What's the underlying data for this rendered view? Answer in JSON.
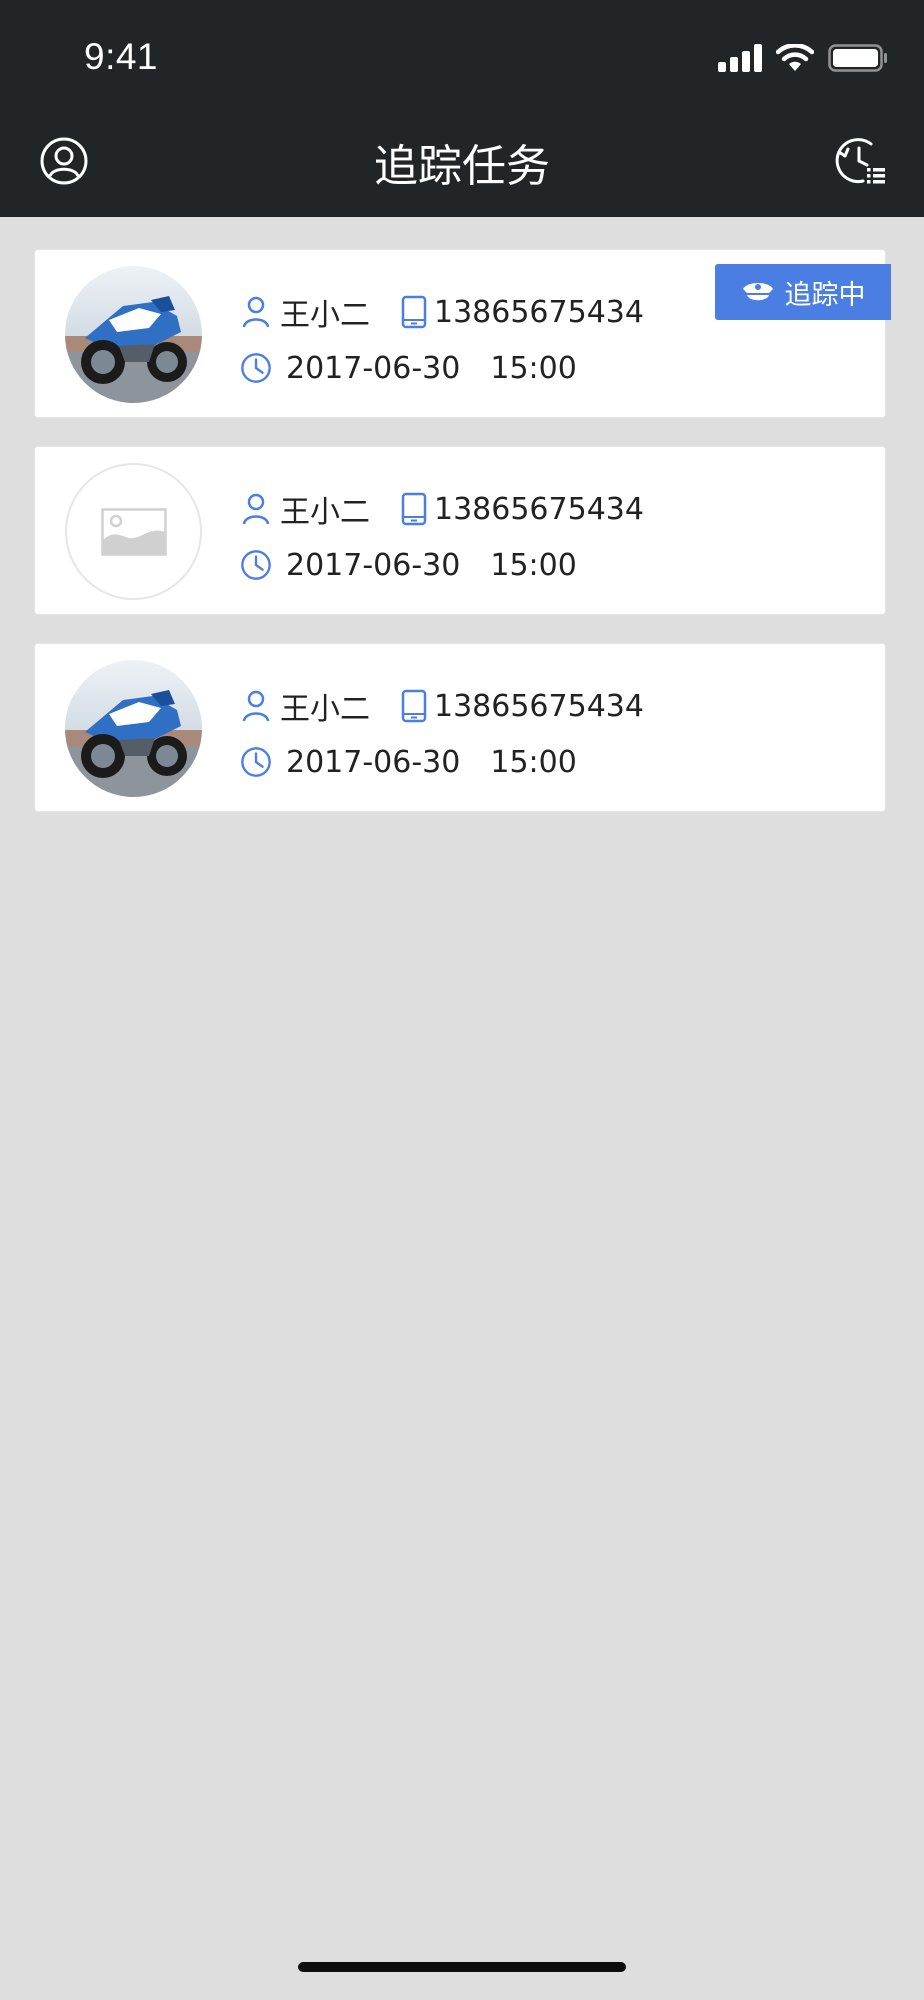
{
  "status_bar": {
    "time": "9:41"
  },
  "header": {
    "title": "追踪任务"
  },
  "badge": {
    "label": "追踪中"
  },
  "tasks": [
    {
      "name": "王小二",
      "phone": "13865675434",
      "date": "2017-06-30",
      "time": "15:00",
      "has_photo": true
    },
    {
      "name": "王小二",
      "phone": "13865675434",
      "date": "2017-06-30",
      "time": "15:00",
      "has_photo": false
    },
    {
      "name": "王小二",
      "phone": "13865675434",
      "date": "2017-06-30",
      "time": "15:00",
      "has_photo": true
    }
  ],
  "colors": {
    "header_bg": "#222528",
    "accent": "#4a7ee3",
    "page_bg": "#dedede",
    "card_bg": "#ffffff"
  }
}
